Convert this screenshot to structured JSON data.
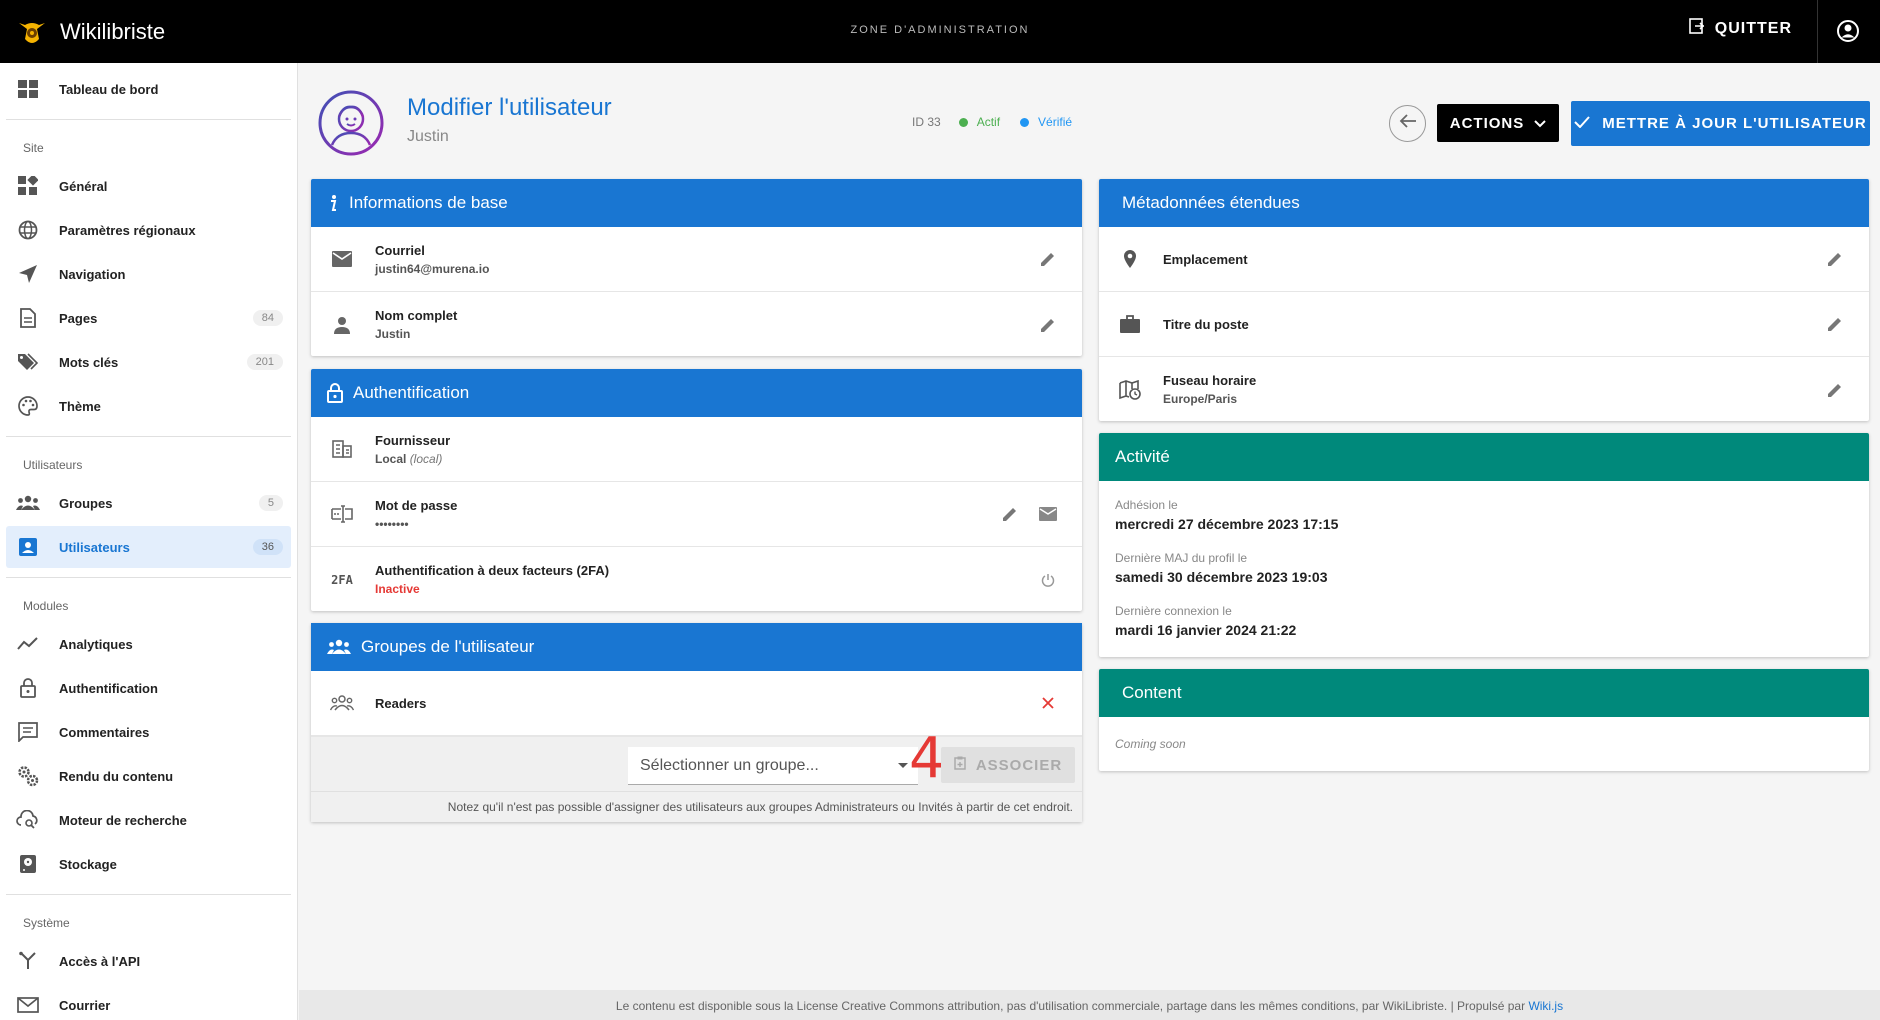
{
  "topbar": {
    "app_title": "Wikilibriste",
    "zone": "ZONE D'ADMINISTRATION",
    "quit_label": "QUITTER"
  },
  "sidebar": {
    "dashboard": "Tableau de bord",
    "sections": {
      "site": "Site",
      "users": "Utilisateurs",
      "modules": "Modules",
      "system": "Système"
    },
    "items": {
      "general": "Général",
      "regional": "Paramètres régionaux",
      "navigation": "Navigation",
      "pages": "Pages",
      "pages_count": "84",
      "tags": "Mots clés",
      "tags_count": "201",
      "theme": "Thème",
      "groups": "Groupes",
      "groups_count": "5",
      "users": "Utilisateurs",
      "users_count": "36",
      "analytics": "Analytiques",
      "auth": "Authentification",
      "comments": "Commentaires",
      "rendering": "Rendu du contenu",
      "search": "Moteur de recherche",
      "storage": "Stockage",
      "api": "Accès à l'API",
      "mail": "Courrier"
    }
  },
  "header": {
    "title": "Modifier l'utilisateur",
    "subtitle": "Justin",
    "id_label": "ID 33",
    "status_active": "Actif",
    "status_verified": "Vérifié",
    "actions_label": "ACTIONS",
    "update_label": "METTRE À JOUR L'UTILISATEUR"
  },
  "basic_info": {
    "title": "Informations de base",
    "email_label": "Courriel",
    "email_value": "justin64@murena.io",
    "name_label": "Nom complet",
    "name_value": "Justin"
  },
  "auth": {
    "title": "Authentification",
    "provider_label": "Fournisseur",
    "provider_value": "Local",
    "provider_key": "(local)",
    "password_label": "Mot de passe",
    "password_value": "••••••••",
    "tfa_label": "Authentification à deux facteurs (2FA)",
    "tfa_value": "Inactive",
    "tfa_icon_text": "2FA"
  },
  "groups": {
    "title": "Groupes de l'utilisateur",
    "items": [
      "Readers"
    ],
    "select_placeholder": "Sélectionner un groupe...",
    "assign_label": "ASSOCIER",
    "notice": "Notez qu'il n'est pas possible d'assigner des utilisateurs aux groupes Administrateurs ou Invités à partir de cet endroit.",
    "annotation": "4"
  },
  "metadata": {
    "title": "Métadonnées étendues",
    "location_label": "Emplacement",
    "job_label": "Titre du poste",
    "timezone_label": "Fuseau horaire",
    "timezone_value": "Europe/Paris"
  },
  "activity": {
    "title": "Activité",
    "joined_label": "Adhésion le",
    "joined_value": "mercredi 27 décembre 2023 17:15",
    "updated_label": "Dernière MAJ du profil le",
    "updated_value": "samedi 30 décembre 2023 19:03",
    "login_label": "Dernière connexion le",
    "login_value": "mardi 16 janvier 2024 21:22"
  },
  "content": {
    "title": "Content",
    "coming": "Coming soon"
  },
  "footer": {
    "text": "Le contenu est disponible sous la License Creative Commons attribution, pas d'utilisation commerciale, partage dans les mêmes conditions, par WikiLibriste. | Propulsé par",
    "link": "Wiki.js"
  },
  "colors": {
    "primary": "#1976d2",
    "teal": "#00897b",
    "active_green": "#4caf50",
    "verified_blue": "#2196f3",
    "danger": "#e53935"
  }
}
